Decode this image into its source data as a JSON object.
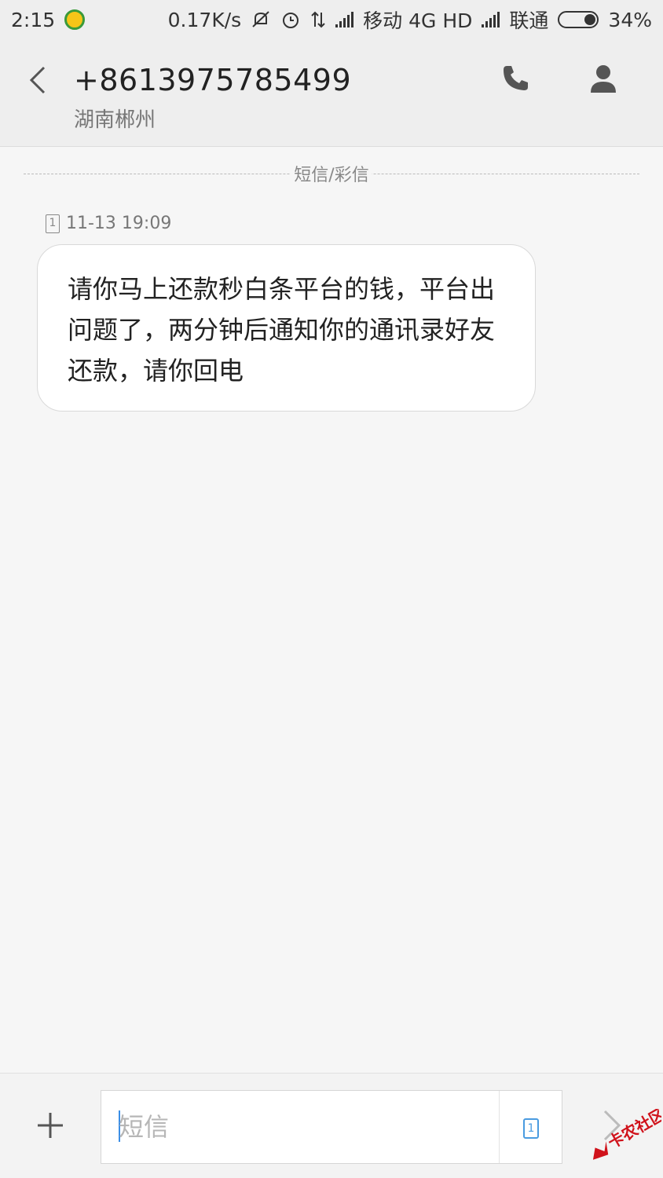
{
  "status_bar": {
    "time": "2:15",
    "net_speed": "0.17K/s",
    "carrier1": "移动 4G HD",
    "carrier2": "联通",
    "battery": "34%"
  },
  "header": {
    "phone_number": "+8613975785499",
    "location": "湖南郴州"
  },
  "thread": {
    "section_label": "短信/彩信",
    "messages": [
      {
        "sim": "1",
        "timestamp": "11-13 19:09",
        "text": "请你马上还款秒白条平台的钱，平台出问题了，两分钟后通知你的通讯录好友还款，请你回电"
      }
    ]
  },
  "composer": {
    "placeholder": "短信",
    "sim": "1"
  },
  "watermark": {
    "text": "卡农社区"
  },
  "colors": {
    "accent": "#4a9be0",
    "watermark_red": "#d0121b"
  }
}
